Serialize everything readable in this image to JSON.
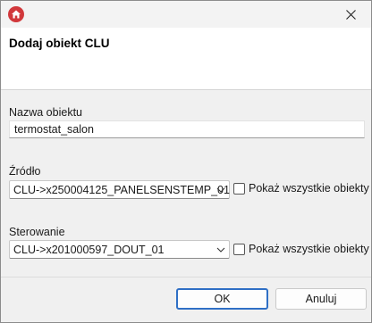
{
  "window": {
    "app_icon": "home-icon",
    "close_icon": "close-icon"
  },
  "header": {
    "title": "Dodaj obiekt CLU"
  },
  "name_field": {
    "label": "Nazwa obiektu",
    "value": "termostat_salon"
  },
  "source": {
    "label": "Źródło",
    "value": "CLU->x250004125_PANELSENSTEMP_01",
    "checkbox_label": "Pokaż wszystkie obiekty",
    "checked": false
  },
  "control": {
    "label": "Sterowanie",
    "value": "CLU->x201000597_DOUT_01",
    "checkbox_label": "Pokaż wszystkie obiekty",
    "checked": false
  },
  "buttons": {
    "ok": "OK",
    "cancel": "Anuluj"
  },
  "colors": {
    "app_icon_red": "#d1383b",
    "ok_border_blue": "#2f6fc5"
  }
}
